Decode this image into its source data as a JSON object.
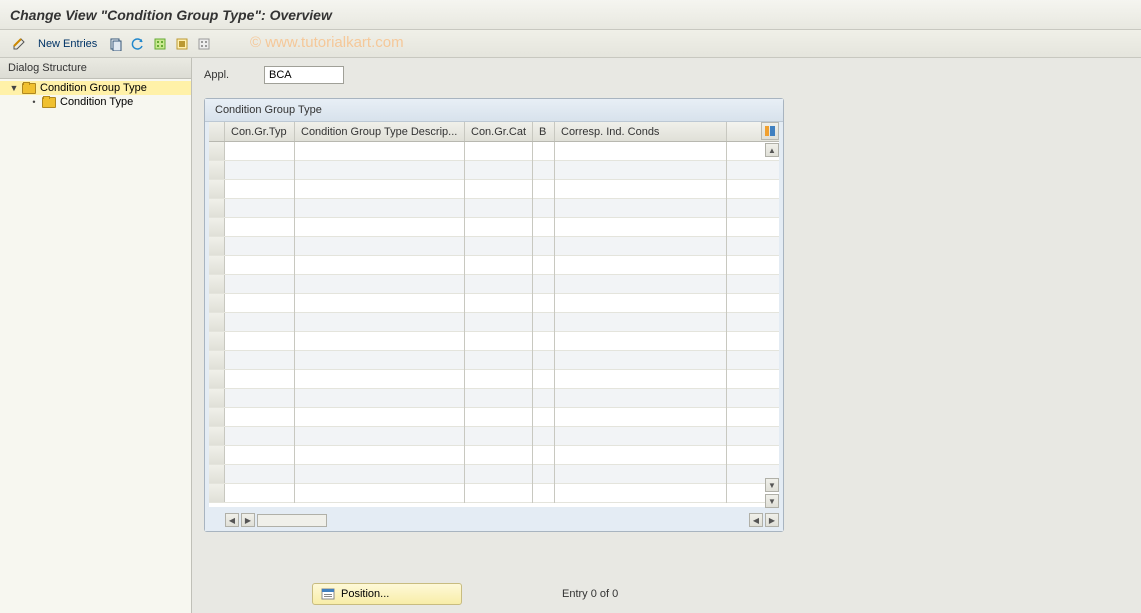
{
  "title": "Change View \"Condition Group Type\": Overview",
  "watermark": "© www.tutorialkart.com",
  "toolbar": {
    "new_entries_label": "New Entries"
  },
  "sidebar": {
    "header": "Dialog Structure",
    "items": [
      {
        "label": "Condition Group Type",
        "selected": true,
        "level": 0,
        "expanded": true
      },
      {
        "label": "Condition Type",
        "selected": false,
        "level": 1,
        "expanded": false
      }
    ]
  },
  "form": {
    "appl_label": "Appl.",
    "appl_value": "BCA"
  },
  "panel": {
    "title": "Condition Group Type",
    "columns": [
      "Con.Gr.Typ",
      "Condition Group Type Descrip...",
      "Con.Gr.Cat",
      "B",
      "Corresp. Ind. Conds"
    ],
    "rows": [
      {},
      {},
      {},
      {},
      {},
      {},
      {},
      {},
      {},
      {},
      {},
      {},
      {},
      {},
      {},
      {},
      {},
      {},
      {}
    ]
  },
  "footer": {
    "position_label": "Position...",
    "entry_text": "Entry 0 of 0"
  }
}
